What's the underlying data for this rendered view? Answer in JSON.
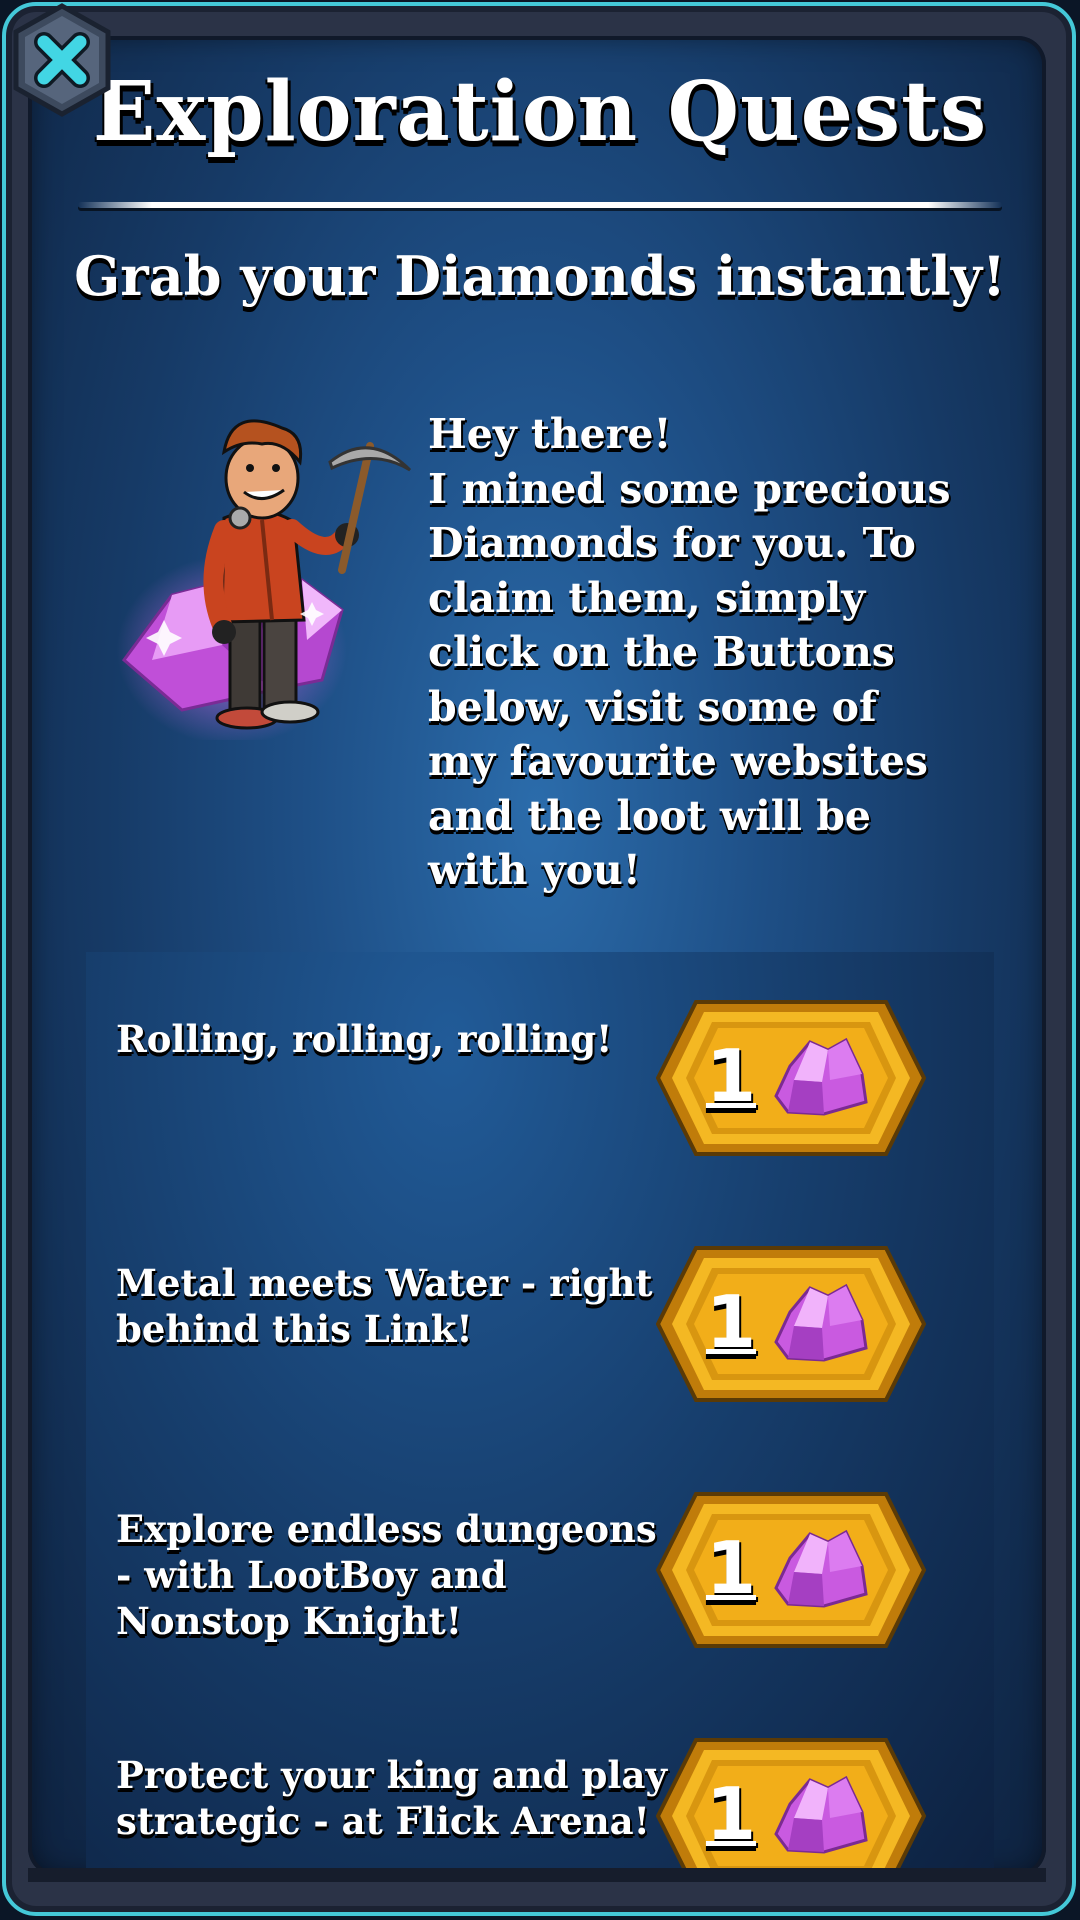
{
  "dialog": {
    "title": "Exploration Quests",
    "subtitle": "Grab your Diamonds instantly!",
    "close_icon": "close-x-icon"
  },
  "intro": {
    "mascot": "miner-with-pickaxe-and-diamonds",
    "text": "Hey there!\nI mined some precious\nDiamonds for you. To\nclaim them, simply\nclick on the Buttons\nbelow, visit some of\nmy favourite websites\nand the loot will be\nwith you!"
  },
  "quests": [
    {
      "text": "Rolling, rolling, rolling!",
      "reward": "1",
      "reward_icon": "diamond-icon"
    },
    {
      "text": "Metal meets Water - right behind this Link!",
      "reward": "1",
      "reward_icon": "diamond-icon"
    },
    {
      "text": "Explore endless dungeons - with LootBoy and Nonstop Knight!",
      "reward": "1",
      "reward_icon": "diamond-icon"
    },
    {
      "text": "Protect your king and play strategic - at Flick Arena!",
      "reward": "1",
      "reward_icon": "diamond-icon"
    }
  ],
  "colors": {
    "frame_border": "#44c8d8",
    "panel_blue": "#1e4f86",
    "reward_gold": "#f1b21c",
    "gem_pink": "#d35ee8"
  }
}
